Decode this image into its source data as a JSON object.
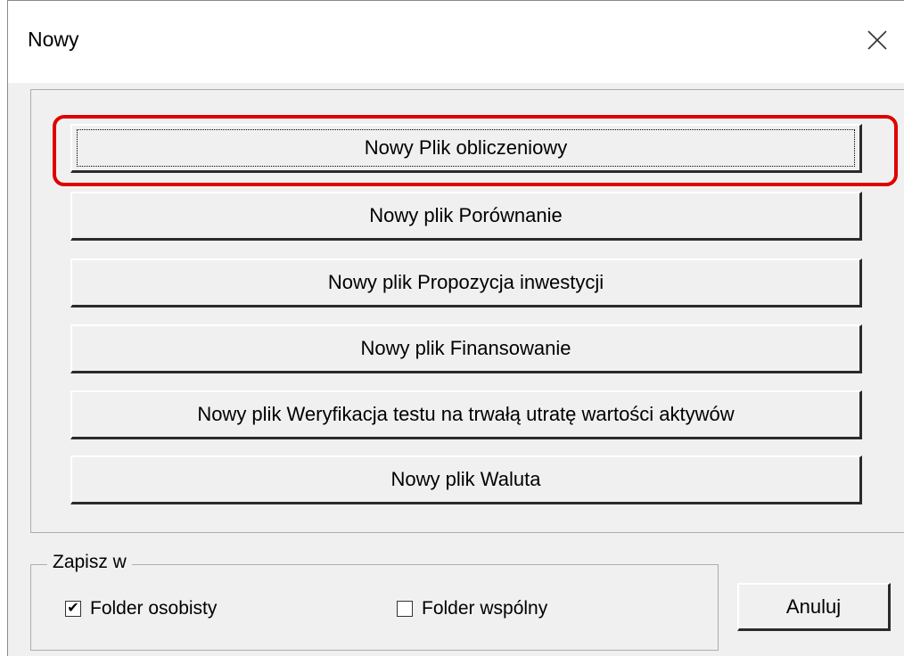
{
  "window": {
    "title": "Nowy",
    "close_icon": "close-icon"
  },
  "buttons": [
    {
      "label": "Nowy Plik obliczeniowy",
      "focused": true,
      "highlighted": true
    },
    {
      "label": "Nowy plik Porównanie"
    },
    {
      "label": "Nowy plik Propozycja inwestycji"
    },
    {
      "label": "Nowy plik Finansowanie"
    },
    {
      "label": "Nowy plik Weryfikacja testu na trwałą utratę wartości aktywów"
    },
    {
      "label": "Nowy plik Waluta"
    }
  ],
  "save_in": {
    "label": "Zapisz w",
    "options": [
      {
        "label": "Folder osobisty",
        "checked": true
      },
      {
        "label": "Folder wspólny",
        "checked": false
      }
    ]
  },
  "cancel_label": "Anuluj",
  "colors": {
    "highlight": "#e00000",
    "dialog_bg": "#f0f0f0"
  }
}
